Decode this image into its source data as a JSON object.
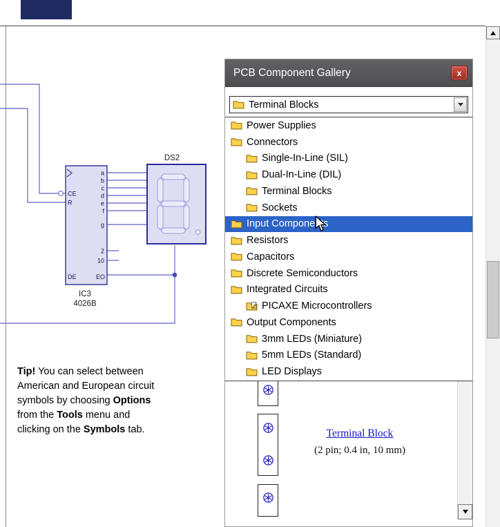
{
  "icons": {
    "folder_icon": "yellow-folder",
    "folder_edit_icon": "yellow-folder-with-pen",
    "close_icon": "x",
    "combo_arrow_icon": "triangle-down",
    "scroll_up_icon": "triangle-up",
    "scroll_down_icon": "triangle-down",
    "mouse_cursor_icon": "arrow-pointer",
    "pad_icon": "circled-asterisk-pad"
  },
  "colors": {
    "titlebar": "#58585B",
    "close_red": "#C23B33",
    "selection_blue": "#2B63C6",
    "wire_blue": "#7A7AD4",
    "component_fill": "#DEDEF2",
    "component_stroke": "#3A3AA0",
    "link_blue": "#1212CC"
  },
  "circuit": {
    "display_ref": "DS2",
    "ic_ref": "IC3",
    "ic_part": "4026B",
    "pins_right": [
      "a",
      "b",
      "c",
      "d",
      "e",
      "f",
      "g"
    ],
    "pins_mid": [
      "2",
      "10"
    ],
    "pins_left": [
      "CE",
      "R"
    ],
    "pins_bottom": [
      "DE",
      "EO"
    ]
  },
  "tip": {
    "bold1": "Tip!",
    "text1": " You can select between American and European circuit symbols by choosing ",
    "bold2": "Options",
    "text2": " from the ",
    "bold3": "Tools",
    "text3": " menu and clicking on the ",
    "bold4": "Symbols",
    "text4": " tab."
  },
  "dialog": {
    "title": "PCB Component Gallery",
    "close_glyph": "x",
    "combo": {
      "value": "Terminal Blocks"
    },
    "list": {
      "items": [
        {
          "label": "Power Supplies",
          "level": 0
        },
        {
          "label": "Connectors",
          "level": 0
        },
        {
          "label": "Single-In-Line (SIL)",
          "level": 1
        },
        {
          "label": "Dual-In-Line (DIL)",
          "level": 1
        },
        {
          "label": "Terminal Blocks",
          "level": 1
        },
        {
          "label": "Sockets",
          "level": 1
        },
        {
          "label": "Input Components",
          "level": 0,
          "selected": true
        },
        {
          "label": "Resistors",
          "level": 0
        },
        {
          "label": "Capacitors",
          "level": 0
        },
        {
          "label": "Discrete Semiconductors",
          "level": 0
        },
        {
          "label": "Integrated Circuits",
          "level": 0
        },
        {
          "label": "PICAXE Microcontrollers",
          "level": 1,
          "icon": "folder-edit"
        },
        {
          "label": "Output Components",
          "level": 0
        },
        {
          "label": "3mm LEDs (Miniature)",
          "level": 1
        },
        {
          "label": "5mm LEDs (Standard)",
          "level": 1
        },
        {
          "label": "LED Displays",
          "level": 1
        }
      ]
    },
    "gallery": {
      "link": "Terminal Block",
      "description": "(2 pin; 0.4 in, 10 mm)"
    }
  }
}
